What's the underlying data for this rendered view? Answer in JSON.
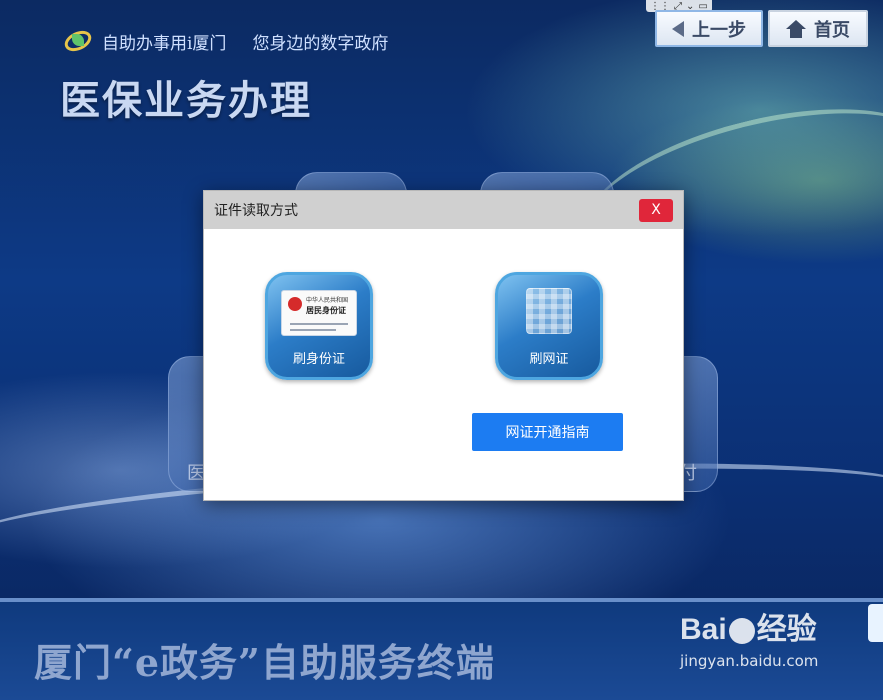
{
  "header": {
    "brand_name": "自助办事用i厦门",
    "slogan": "您身边的数字政府",
    "page_title": "医保业务办理"
  },
  "nav": {
    "back_label": "上一步",
    "home_label": "首页",
    "mini_icons": [
      "grid-icon",
      "expand-icon",
      "chevron-down-icon",
      "window-icon"
    ]
  },
  "background_tiles": {
    "left_label_partial": "医",
    "right_label_partial": "付"
  },
  "modal": {
    "title": "证件读取方式",
    "close_label": "X",
    "options": [
      {
        "label": "刷身份证",
        "icon": "id-card-icon",
        "card_header": "中华人民共和国",
        "card_title": "居民身份证"
      },
      {
        "label": "刷网证",
        "icon": "qr-code-icon"
      }
    ],
    "guide_button_label": "网证开通指南"
  },
  "footer": {
    "title": "厦门“e政务”自助服务终端"
  },
  "watermark": {
    "logo_text_a": "Bai",
    "logo_text_b": "经验",
    "url": "jingyan.baidu.com"
  },
  "colors": {
    "close_red": "#e0263a",
    "primary_blue": "#1c7cf2",
    "modal_header_gray": "#d0d0d0"
  }
}
